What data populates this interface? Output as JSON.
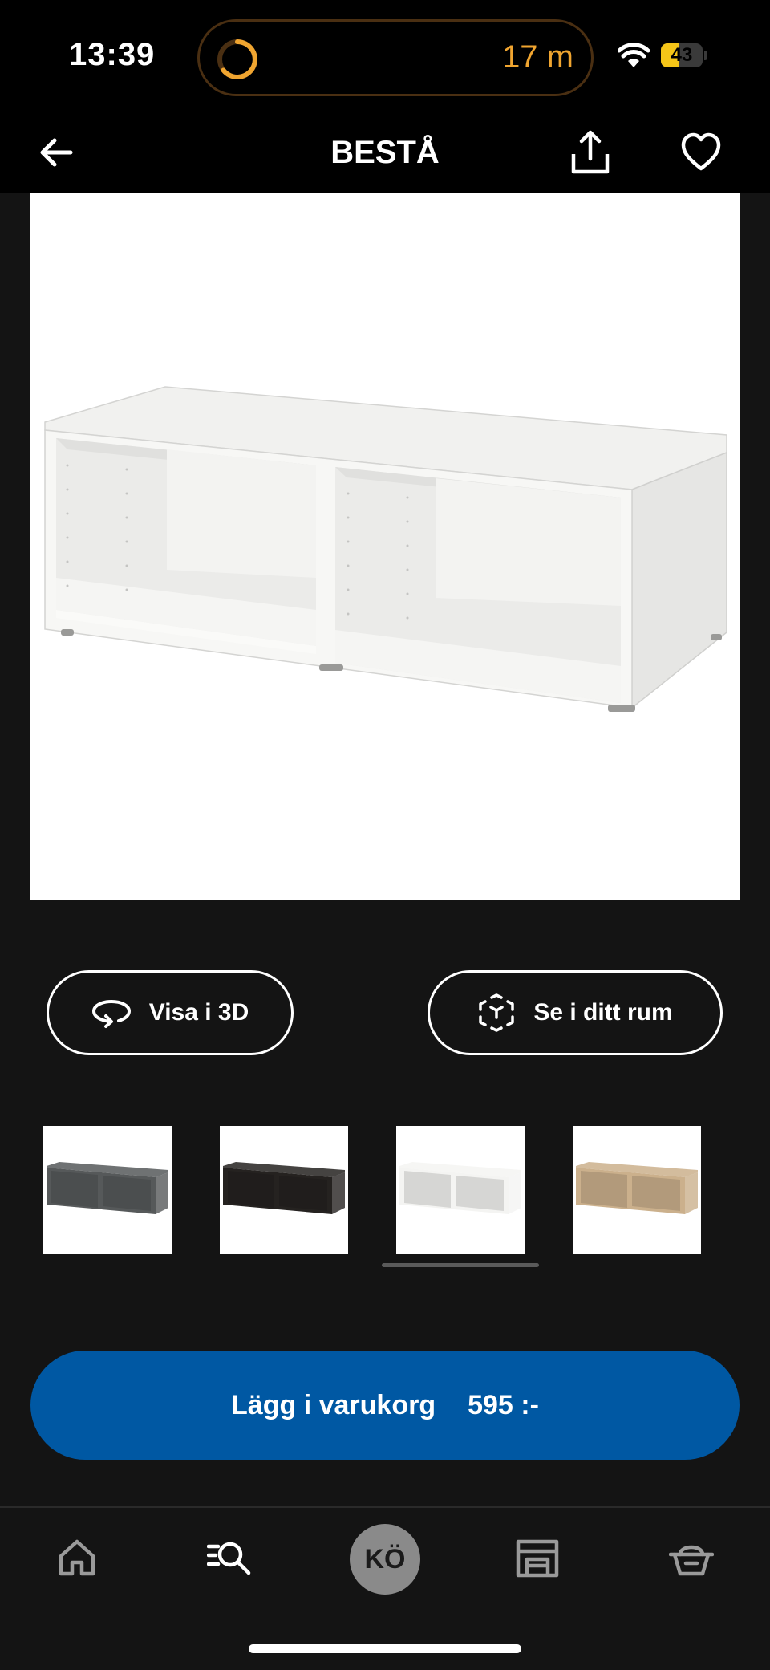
{
  "status_bar": {
    "time": "13:39",
    "live_activity_duration": "17 m",
    "battery_level": "43",
    "battery_fraction": 0.43
  },
  "header": {
    "title": "BESTÅ",
    "back_icon": "arrow-left-icon",
    "share_icon": "share-icon",
    "favorite_icon": "heart-icon"
  },
  "product": {
    "image": "white-tv-bench-image",
    "actions": {
      "view_3d_label": "Visa i 3D",
      "view_3d_icon": "rotate-3d-icon",
      "see_in_room_label": "Se i ditt rum",
      "see_in_room_icon": "ar-cube-icon"
    },
    "variants": [
      {
        "name": "dark-grey",
        "color": "#56595a"
      },
      {
        "name": "black-brown",
        "color": "#252220"
      },
      {
        "name": "white",
        "color": "#f4f4f2",
        "selected": true
      },
      {
        "name": "white-stained-oak",
        "color": "#cbb08c"
      }
    ]
  },
  "cart": {
    "label": "Lägg i varukorg",
    "price": "595 :-",
    "color": "#0058a3"
  },
  "bottom_nav": {
    "items": [
      {
        "icon": "home-icon"
      },
      {
        "icon": "search-icon",
        "active": true
      },
      {
        "label": "KÖ"
      },
      {
        "icon": "store-icon"
      },
      {
        "icon": "basket-icon"
      }
    ]
  }
}
